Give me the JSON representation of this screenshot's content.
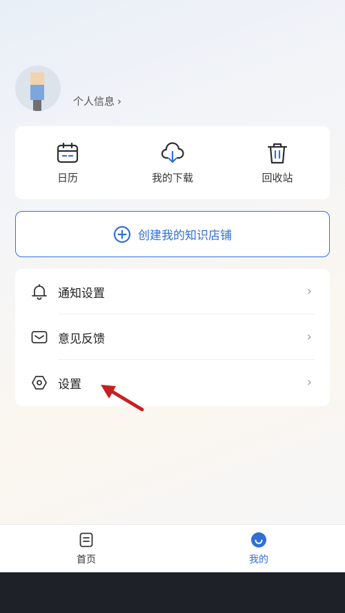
{
  "profile": {
    "info_label": "个人信息",
    "chevron": "›"
  },
  "quick_actions": [
    {
      "icon": "calendar-icon",
      "label": "日历"
    },
    {
      "icon": "cloud-download-icon",
      "label": "我的下载"
    },
    {
      "icon": "trash-icon",
      "label": "回收站"
    }
  ],
  "create_store": {
    "icon": "plus-circle-icon",
    "label": "创建我的知识店铺"
  },
  "menu": [
    {
      "icon": "bell-icon",
      "label": "通知设置",
      "chevron": "›"
    },
    {
      "icon": "mail-icon",
      "label": "意见反馈",
      "chevron": "›"
    },
    {
      "icon": "settings-hexagon-icon",
      "label": "设置",
      "chevron": "›"
    }
  ],
  "tabbar": [
    {
      "icon": "document-icon",
      "label": "首页",
      "active": false
    },
    {
      "icon": "smile-icon",
      "label": "我的",
      "active": true
    }
  ],
  "colors": {
    "accent": "#2f6fd6",
    "annotation_arrow": "#c62020",
    "system_nav": "#1f2129"
  }
}
